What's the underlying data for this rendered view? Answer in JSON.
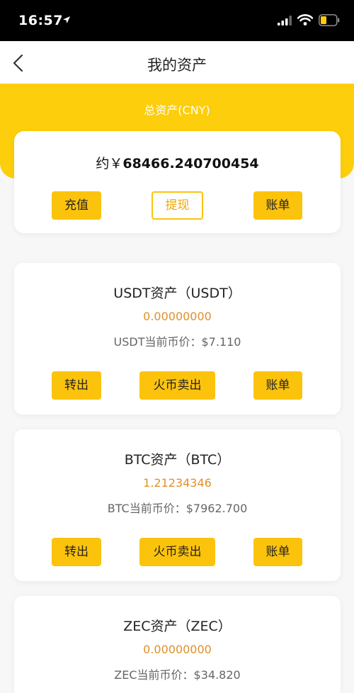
{
  "status": {
    "time": "16:57"
  },
  "nav": {
    "title": "我的资产"
  },
  "summary": {
    "label": "总资产(CNY)",
    "prefix": "约￥",
    "amount": "68466.240700454",
    "buttons": {
      "deposit": "充值",
      "withdraw": "提现",
      "bill": "账单"
    }
  },
  "assets": [
    {
      "title": "USDT资产（USDT）",
      "balance": "0.00000000",
      "price": "USDT当前币价：$7.110",
      "buttons": {
        "transfer": "转出",
        "sell": "火币卖出",
        "bill": "账单"
      }
    },
    {
      "title": "BTC资产（BTC）",
      "balance": "1.21234346",
      "price": "BTC当前币价：$7962.700",
      "buttons": {
        "transfer": "转出",
        "sell": "火币卖出",
        "bill": "账单"
      }
    },
    {
      "title": "ZEC资产（ZEC）",
      "balance": "0.00000000",
      "price": "ZEC当前币价：$34.820"
    }
  ],
  "colors": {
    "accent": "#fcce0b",
    "button": "#fcc30d",
    "balance": "#e0902a"
  }
}
